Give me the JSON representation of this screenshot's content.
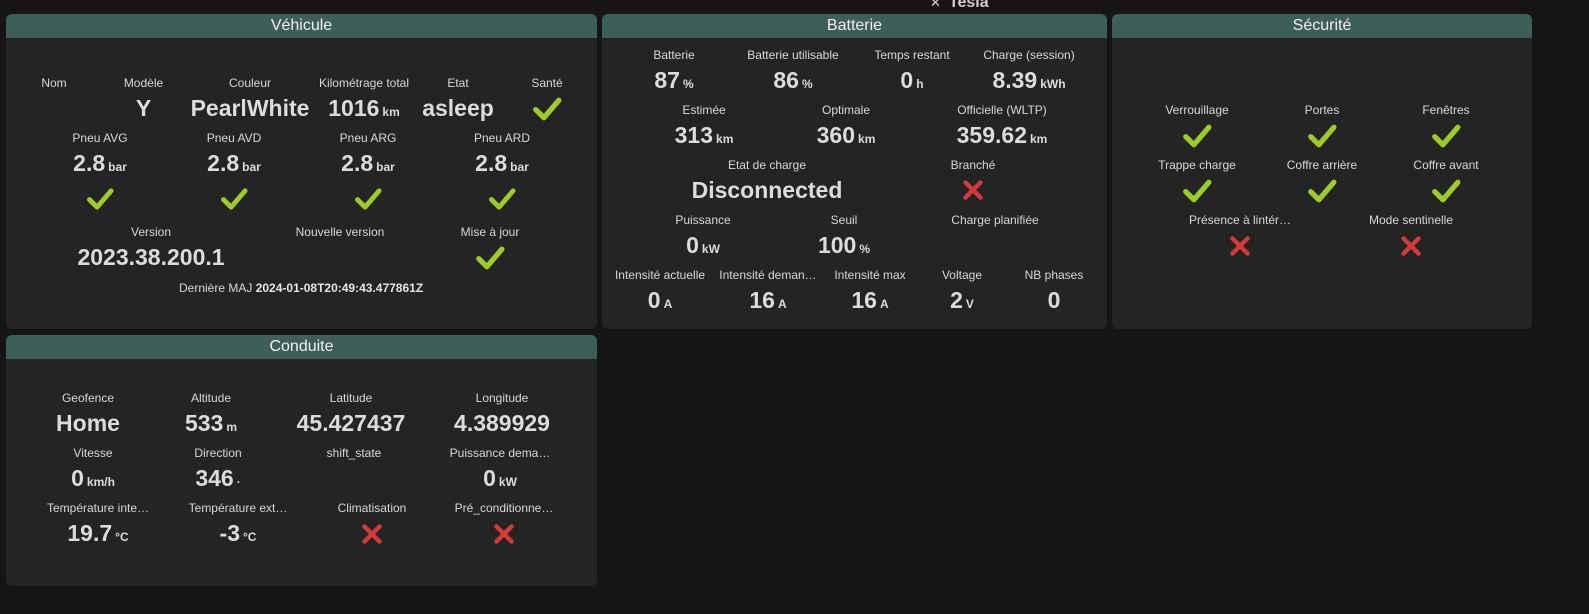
{
  "header": {
    "title": "Tesla"
  },
  "colors": {
    "accent": "#3e5e58",
    "ok": "#9ccc2a",
    "error": "#d33b3b"
  },
  "vehicule": {
    "title": "Véhicule",
    "nom_label": "Nom",
    "modele_label": "Modèle",
    "modele_value": "Y",
    "couleur_label": "Couleur",
    "couleur_value": "PearlWhite",
    "km_label": "Kilométrage total",
    "km_value": "1016",
    "km_unit": "km",
    "etat_label": "Etat",
    "etat_value": "asleep",
    "sante_label": "Santé",
    "pneu_avg_label": "Pneu AVG",
    "pneu_avg_value": "2.8",
    "pneu_avd_label": "Pneu AVD",
    "pneu_avd_value": "2.8",
    "pneu_arg_label": "Pneu ARG",
    "pneu_arg_value": "2.8",
    "pneu_ard_label": "Pneu ARD",
    "pneu_ard_value": "2.8",
    "pressure_unit": "bar",
    "version_label": "Version",
    "version_value": "2023.38.200.1",
    "nouvelle_version_label": "Nouvelle version",
    "maj_label": "Mise à jour",
    "derniere_maj_label": "Dernière MAJ",
    "derniere_maj_value": "2024-01-08T20:49:43.477861Z"
  },
  "batterie": {
    "title": "Batterie",
    "batterie_label": "Batterie",
    "batterie_value": "87",
    "percent_unit": "%",
    "utilisable_label": "Batterie utilisable",
    "utilisable_value": "86",
    "temps_label": "Temps restant",
    "temps_value": "0",
    "temps_unit": "h",
    "charge_label": "Charge (session)",
    "charge_value": "8.39",
    "charge_unit": "kWh",
    "estimee_label": "Estimée",
    "estimee_value": "313",
    "optimale_label": "Optimale",
    "optimale_value": "360",
    "wltp_label": "Officielle (WLTP)",
    "wltp_value": "359.62",
    "km_unit": "km",
    "etat_charge_label": "Etat de charge",
    "etat_charge_value": "Disconnected",
    "branche_label": "Branché",
    "puissance_label": "Puissance",
    "puissance_value": "0",
    "kw_unit": "kW",
    "seuil_label": "Seuil",
    "seuil_value": "100",
    "planifiee_label": "Charge planifiée",
    "intensite_actuelle_label": "Intensité actuelle",
    "intensite_actuelle_value": "0",
    "intensite_demandee_label": "Intensité deman…",
    "intensite_demandee_value": "16",
    "intensite_max_label": "Intensité max",
    "intensite_max_value": "16",
    "amp_unit": "A",
    "voltage_label": "Voltage",
    "voltage_value": "2",
    "voltage_unit": "V",
    "phases_label": "NB phases",
    "phases_value": "0"
  },
  "securite": {
    "title": "Sécurité",
    "verrouillage_label": "Verrouillage",
    "portes_label": "Portes",
    "fenetres_label": "Fenêtres",
    "trappe_label": "Trappe charge",
    "coffre_arriere_label": "Coffre arrière",
    "coffre_avant_label": "Coffre avant",
    "presence_label": "Présence à lintér…",
    "sentinelle_label": "Mode sentinelle"
  },
  "conduite": {
    "title": "Conduite",
    "geofence_label": "Geofence",
    "geofence_value": "Home",
    "altitude_label": "Altitude",
    "altitude_value": "533",
    "altitude_unit": "m",
    "latitude_label": "Latitude",
    "latitude_value": "45.427437",
    "longitude_label": "Longitude",
    "longitude_value": "4.389929",
    "vitesse_label": "Vitesse",
    "vitesse_value": "0",
    "vitesse_unit": "km/h",
    "direction_label": "Direction",
    "direction_value": "346",
    "direction_unit": "·",
    "shift_label": "shift_state",
    "puissance_label": "Puissance dema…",
    "puissance_value": "0",
    "kw_unit": "kW",
    "temp_int_label": "Température inte…",
    "temp_int_value": "19.7",
    "temp_ext_label": "Température ext…",
    "temp_ext_value": "-3",
    "temp_unit": "°C",
    "clim_label": "Climatisation",
    "precond_label": "Pré_conditionne…"
  }
}
